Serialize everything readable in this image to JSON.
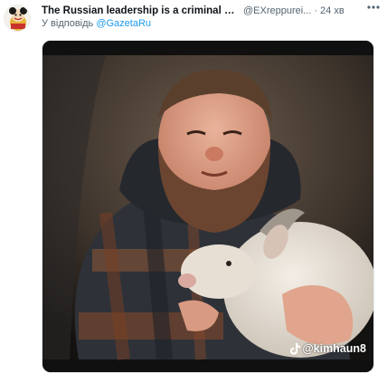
{
  "tweet": {
    "author_name": "The Russian leadership is a criminal orga...",
    "handle": "@EXreppurei...",
    "separator": "·",
    "time": "24 хв",
    "reply_prefix": "У відповідь ",
    "reply_mention": "@GazetaRu",
    "more_icon": "more-horizontal-icon"
  },
  "media": {
    "watermark_icon": "tiktok-icon",
    "watermark_text": "@kimhaun8"
  },
  "colors": {
    "secondary_text": "#536471",
    "link": "#1d9bf0",
    "text": "#0f1419"
  }
}
